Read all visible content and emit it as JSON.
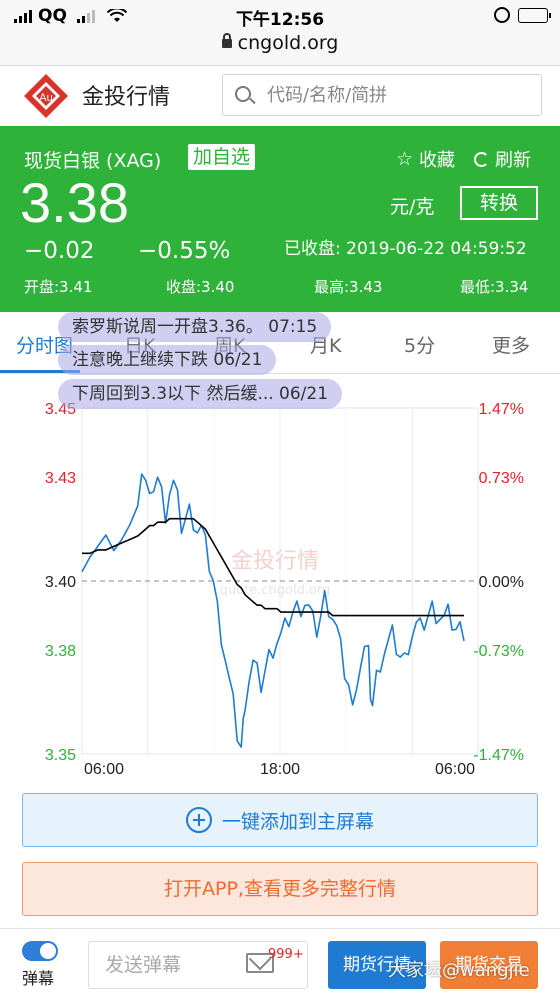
{
  "status_bar": {
    "carrier": "QQ",
    "time": "下午12:56",
    "url": "cngold.org"
  },
  "header": {
    "logo_text": "Au",
    "brand": "金投行情",
    "search_placeholder": "代码/名称/简拼"
  },
  "quote": {
    "name": "现货白银 (XAG)",
    "add_fav": "加自选",
    "favorite": "收藏",
    "refresh": "刷新",
    "price": "3.38",
    "unit": "元/克",
    "convert": "转换",
    "change": "−0.02",
    "change_pct": "−0.55%",
    "closed": "已收盘: 2019-06-22 04:59:52",
    "open": "开盘:3.41",
    "prev_close": "收盘:3.40",
    "high": "最高:3.43",
    "low": "最低:3.34"
  },
  "tabs": [
    "分时图",
    "日K",
    "周K",
    "月K",
    "5分",
    "更多"
  ],
  "danmaku": [
    "索罗斯说周一开盘3.36。 07:15",
    "注意晚上继续下跌 06/21",
    "下周回到3.3以下 然后缓... 06/21"
  ],
  "chart_data": {
    "type": "line",
    "ylim": [
      3.35,
      3.45
    ],
    "yticks_left": [
      "3.45",
      "3.43",
      "3.40",
      "3.38",
      "3.35"
    ],
    "yticks_right": [
      "1.47%",
      "0.73%",
      "0.00%",
      "-0.73%",
      "-1.47%"
    ],
    "x_ticks": [
      "06:00",
      "18:00",
      "06:00"
    ],
    "reference": 3.4,
    "watermark": "金投行情",
    "watermark_sub": "quote.cngold.org",
    "colors": {
      "price": "#1f7bd1",
      "average": "#000000",
      "up": "#e8202a",
      "down": "#2eb239"
    },
    "x": [
      0,
      8,
      16,
      24,
      32,
      40,
      48,
      56,
      60,
      64,
      68,
      72,
      76,
      80,
      84,
      88,
      92,
      96,
      100,
      104,
      108,
      112,
      116,
      120,
      124,
      128,
      132,
      136,
      140,
      144,
      148,
      152,
      156,
      160,
      162,
      164,
      168,
      172,
      176,
      180,
      184,
      188,
      192,
      196,
      200,
      204,
      208,
      212,
      216,
      220,
      224,
      228,
      232,
      236,
      240,
      244,
      248,
      252,
      256,
      260,
      264,
      268,
      272,
      276,
      280,
      284,
      288,
      290,
      292,
      296,
      300,
      304,
      308,
      312,
      316,
      320,
      324,
      328,
      332,
      336,
      340,
      344,
      348,
      352,
      356,
      360,
      364,
      368,
      372,
      376,
      380,
      384
    ],
    "series": [
      {
        "values": [
          3.406,
          3.408,
          3.409,
          3.41,
          3.411,
          3.412,
          3.414,
          3.425,
          3.432,
          3.428,
          3.422,
          3.428,
          3.43,
          3.425,
          3.42,
          3.426,
          3.428,
          3.423,
          3.416,
          3.418,
          3.42,
          3.418,
          3.415,
          3.415,
          3.41,
          3.405,
          3.4,
          3.392,
          3.385,
          3.378,
          3.371,
          3.364,
          3.356,
          3.352,
          3.358,
          3.366,
          3.372,
          3.376,
          3.373,
          3.37,
          3.374,
          3.378,
          3.381,
          3.383,
          3.384,
          3.386,
          3.389,
          3.391,
          3.392,
          3.393,
          3.394,
          3.392,
          3.388,
          3.386,
          3.39,
          3.395,
          3.393,
          3.39,
          3.386,
          3.38,
          3.374,
          3.37,
          3.362,
          3.372,
          3.376,
          3.38,
          3.378,
          3.368,
          3.364,
          3.372,
          3.377,
          3.38,
          3.382,
          3.384,
          3.381,
          3.378,
          3.377,
          3.382,
          3.385,
          3.387,
          3.386,
          3.388,
          3.39,
          3.392,
          3.391,
          3.39,
          3.389,
          3.39,
          3.388,
          3.386,
          3.386,
          3.386
        ]
      },
      {
        "values": [
          3.408,
          3.408,
          3.409,
          3.409,
          3.41,
          3.411,
          3.412,
          3.413,
          3.414,
          3.415,
          3.416,
          3.416,
          3.417,
          3.417,
          3.417,
          3.418,
          3.418,
          3.418,
          3.418,
          3.418,
          3.418,
          3.418,
          3.417,
          3.416,
          3.415,
          3.413,
          3.411,
          3.409,
          3.407,
          3.405,
          3.403,
          3.401,
          3.399,
          3.398,
          3.397,
          3.396,
          3.395,
          3.394,
          3.393,
          3.393,
          3.392,
          3.392,
          3.392,
          3.392,
          3.391,
          3.391,
          3.391,
          3.391,
          3.391,
          3.391,
          3.391,
          3.391,
          3.391,
          3.391,
          3.391,
          3.391,
          3.391,
          3.39,
          3.39,
          3.39,
          3.39,
          3.39,
          3.39,
          3.39,
          3.39,
          3.39,
          3.39,
          3.39,
          3.39,
          3.39,
          3.39,
          3.39,
          3.39,
          3.39,
          3.39,
          3.39,
          3.39,
          3.39,
          3.39,
          3.39,
          3.39,
          3.39,
          3.39,
          3.39,
          3.39,
          3.39,
          3.39,
          3.39,
          3.39,
          3.39,
          3.39,
          3.39
        ]
      }
    ]
  },
  "buttons": {
    "add_home": "一键添加到主屏幕",
    "open_app": "打开APP,查看更多完整行情"
  },
  "bottom": {
    "toggle_label": "弹幕",
    "toggle_on": true,
    "input_placeholder": "发送弹幕",
    "mail_count": "999+",
    "futures": "期货行情",
    "trade": "期货交易"
  },
  "watermark": "大家坛@wangjie"
}
